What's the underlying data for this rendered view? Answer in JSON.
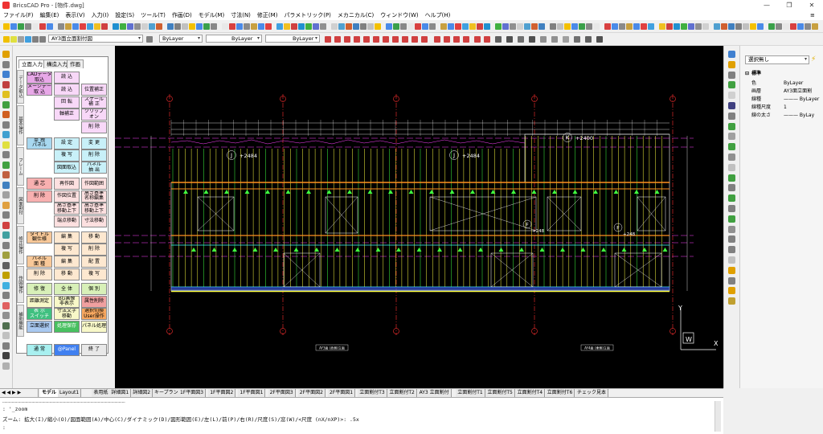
{
  "window": {
    "title": "BricsCAD Pro - [物件.dwg]",
    "minimize": "—",
    "maximize": "❐",
    "close": "✕"
  },
  "menu": [
    "ファイル(F)",
    "編集(E)",
    "表示(V)",
    "入力(I)",
    "設定(S)",
    "ツール(T)",
    "作画(D)",
    "モデル(M)",
    "寸法(N)",
    "修正(M)",
    "パラメトリック(P)",
    "メカニカル(C)",
    "ウィンドウ(W)",
    "ヘルプ(H)"
  ],
  "toolbar": {
    "layer_dropdown": "AY3面立面割付図",
    "color_dropdown": "ByLayer",
    "linetype_dropdown": "ByLayer",
    "lineweight_dropdown": "ByLayer"
  },
  "panel": {
    "tabs": [
      "立面入力",
      "構造入力",
      "作画"
    ],
    "side_tabs": [
      "データ取込",
      "基本操作",
      "フレーム",
      "図面割付",
      "修正操作",
      "作図操作",
      "補助機能"
    ],
    "buttons": [
      {
        "label": "CADデータ\n取込",
        "bg": "#e8a8e8"
      },
      {
        "label": "読 込",
        "bg": "#f8d8f8"
      },
      {
        "label": "イメージデータ\n取 込",
        "bg": "#e8a8e8"
      },
      {
        "label": "読 込",
        "bg": "#f8d8f8"
      },
      {
        "label": "位置補正",
        "bg": "#f8d8f8"
      },
      {
        "label": "回 転",
        "bg": "#f8d8f8"
      },
      {
        "label": "スケール\n補 正",
        "bg": "#f8d8f8"
      },
      {
        "label": "軸補正",
        "bg": "#f8d8f8"
      },
      {
        "label": "クリップ\nオン",
        "bg": "#f8d8f8"
      },
      {
        "label": "削 除",
        "bg": "#f8d8f8"
      },
      {
        "label": "単 独\nパネル",
        "bg": "#a8d8f0"
      },
      {
        "label": "設 定",
        "bg": "#c8f0f8"
      },
      {
        "label": "変 更",
        "bg": "#c8f0f8"
      },
      {
        "label": "複 写",
        "bg": "#c8f0f8"
      },
      {
        "label": "削 除",
        "bg": "#c8f0f8"
      },
      {
        "label": "図面取込",
        "bg": "#c8f0f8"
      },
      {
        "label": "パネル\n抽 出",
        "bg": "#c8f0f8"
      },
      {
        "label": "通 芯",
        "bg": "#f8b0b0"
      },
      {
        "label": "再作図",
        "bg": "#fde0e0"
      },
      {
        "label": "作図範囲",
        "bg": "#fde0e0"
      },
      {
        "label": "削 除",
        "bg": "#f8b0b0"
      },
      {
        "label": "作図位置",
        "bg": "#fde0e0"
      },
      {
        "label": "高さ基準\n名称編集",
        "bg": "#fde0e0"
      },
      {
        "label": "高さ基準\n移動上下",
        "bg": "#fde0e0"
      },
      {
        "label": "高さ基準\n移動上下",
        "bg": "#fde0e0"
      },
      {
        "label": "端点移動",
        "bg": "#fde0e0"
      },
      {
        "label": "寸法移動",
        "bg": "#fde0e0"
      },
      {
        "label": "タイトル\n観仕様",
        "bg": "#f8c898"
      },
      {
        "label": "編 集",
        "bg": "#fde8d0"
      },
      {
        "label": "移 動",
        "bg": "#fde8d0"
      },
      {
        "label": "複 写",
        "bg": "#fde8d0"
      },
      {
        "label": "削 除",
        "bg": "#fde8d0"
      },
      {
        "label": "パネル\n面 種",
        "bg": "#f8c898"
      },
      {
        "label": "編 集",
        "bg": "#fde8d0"
      },
      {
        "label": "配 置",
        "bg": "#fde8d0"
      },
      {
        "label": "削 除",
        "bg": "#fde8d0"
      },
      {
        "label": "移 動",
        "bg": "#fde8d0"
      },
      {
        "label": "複 写",
        "bg": "#fde8d0"
      },
      {
        "label": "修 復",
        "bg": "#d8f0b8"
      },
      {
        "label": "全 体",
        "bg": "#d8f0b8"
      },
      {
        "label": "個 別",
        "bg": "#d8f0b8"
      },
      {
        "label": "距離測定",
        "bg": "#f8f8c8"
      },
      {
        "label": "BG画像\n非表示",
        "bg": "#f8f8c8"
      },
      {
        "label": "属性削除",
        "bg": "#f0a0a0"
      },
      {
        "label": "表 示\nスイッチ",
        "bg": "#40c080"
      },
      {
        "label": "寸法文字\n移動",
        "bg": "#f8f8c8"
      },
      {
        "label": "選択切換\nUser操作",
        "bg": "#f8a860"
      },
      {
        "label": "立面選択",
        "bg": "#a8c8f0"
      },
      {
        "label": "処理保存",
        "bg": "#48c060"
      },
      {
        "label": "パネル処理",
        "bg": "#f8f8c8"
      },
      {
        "label": "通 常",
        "bg": "#a8f0f0"
      },
      {
        "label": "@Panel",
        "bg": "#4080f0"
      },
      {
        "label": "終 了",
        "bg": "#e8e8e8"
      }
    ]
  },
  "drawing": {
    "labels_top": [
      "J",
      "J",
      "K"
    ],
    "dims_top": [
      "+2484",
      "+2484",
      "+2400"
    ],
    "mid_labels": [
      "F",
      "F"
    ],
    "mid_dims": [
      "+248",
      "+248"
    ],
    "title_blocks": [
      "AY3面 (西側)立面",
      "AY4面 (東側)立面"
    ],
    "axis_x": "X",
    "axis_y": "Y",
    "axis_w": "W",
    "colors": {
      "red": "#ff3030",
      "magenta": "#ff40ff",
      "yellow": "#ffff40",
      "green": "#40ff40",
      "cyan": "#40ffff",
      "orange": "#ff9020",
      "white": "#ffffff",
      "blue": "#4060ff"
    }
  },
  "properties": {
    "selection": "選択無し",
    "section": "標準",
    "rows": [
      {
        "k": "色",
        "v": "ByLayer"
      },
      {
        "k": "画層",
        "v": "AY3面立面割"
      },
      {
        "k": "線種",
        "v": "——— ByLayer"
      },
      {
        "k": "線種尺度",
        "v": "1"
      },
      {
        "k": "線の太さ",
        "v": "——— ByLay"
      }
    ]
  },
  "layout_tabs": [
    "モデル",
    "Layout1",
    "表用紙",
    "詳細図1",
    "詳細図2",
    "キープラン",
    "1F平面図3",
    "1F平面図2",
    "1F平面図1",
    "2F平面図3",
    "2F平面図2",
    "2F平面図1",
    "立面割付T3",
    "立面割付T2",
    "AY3 立面割付",
    "立面割付T1",
    "立面割付T5",
    "立面割付T4",
    "立面割付T6",
    "チェック見本"
  ],
  "command": {
    "history": ": '_zoom",
    "line1": "ズーム: 拡大(I)/縮小(O)/図面範囲(A)/中心(C)/ダイナミック(D)/図形範囲(E)/左(L)/前(P)/右(R)/尺度(S)/窓(W)/<尺度 (nX/nXP)>: .5x",
    "prompt": ":"
  }
}
